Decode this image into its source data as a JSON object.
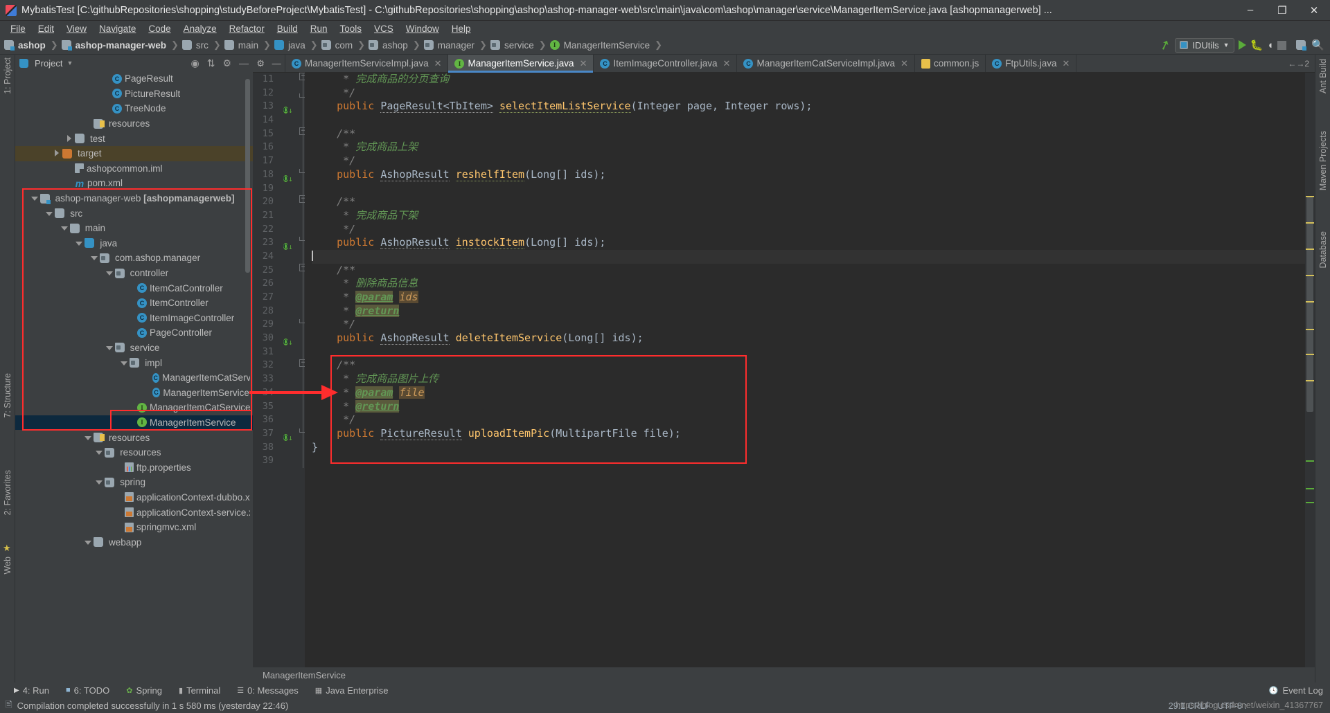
{
  "window": {
    "title": "MybatisTest [C:\\githubRepositories\\shopping\\studyBeforeProject\\MybatisTest] - C:\\githubRepositories\\shopping\\ashop\\ashop-manager-web\\src\\main\\java\\com\\ashop\\manager\\service\\ManagerItemService.java [ashopmanagerweb] ...",
    "minimize": "–",
    "maximize": "❐",
    "close": "✕"
  },
  "menubar": [
    {
      "label": "File"
    },
    {
      "label": "Edit"
    },
    {
      "label": "View"
    },
    {
      "label": "Navigate"
    },
    {
      "label": "Code"
    },
    {
      "label": "Analyze"
    },
    {
      "label": "Refactor"
    },
    {
      "label": "Build"
    },
    {
      "label": "Run"
    },
    {
      "label": "Tools"
    },
    {
      "label": "VCS"
    },
    {
      "label": "Window"
    },
    {
      "label": "Help"
    }
  ],
  "navbar": {
    "crumbs": [
      {
        "label": "ashop",
        "icon": "module-folder-icon",
        "bold": true
      },
      {
        "label": "ashop-manager-web",
        "icon": "module-folder-icon",
        "bold": true
      },
      {
        "label": "src",
        "icon": "folder-icon",
        "bold": false
      },
      {
        "label": "main",
        "icon": "folder-icon",
        "bold": false
      },
      {
        "label": "java",
        "icon": "source-folder-icon",
        "bold": false
      },
      {
        "label": "com",
        "icon": "package-icon",
        "bold": false
      },
      {
        "label": "ashop",
        "icon": "package-icon",
        "bold": false
      },
      {
        "label": "manager",
        "icon": "package-icon",
        "bold": false
      },
      {
        "label": "service",
        "icon": "package-icon",
        "bold": false
      },
      {
        "label": "ManagerItemService",
        "icon": "interface-icon",
        "bold": false
      }
    ],
    "run_config": "IDUtils",
    "buttons": [
      "run-button",
      "debug-button",
      "run-coverage-button",
      "stop-button",
      "project-structure-button",
      "search-everywhere-button"
    ]
  },
  "project_panel": {
    "title": "Project",
    "tools": [
      "locate-icon",
      "collapse-all-icon",
      "settings-icon",
      "hide-icon"
    ],
    "tree": [
      {
        "label": "PageResult",
        "indent": 7,
        "icon": "class-icon",
        "arrow": "none",
        "state": "normal"
      },
      {
        "label": "PictureResult",
        "indent": 7,
        "icon": "class-icon",
        "arrow": "none",
        "state": "normal"
      },
      {
        "label": "TreeNode",
        "indent": 7,
        "icon": "class-icon",
        "arrow": "none",
        "state": "normal"
      },
      {
        "label": "resources",
        "indent": 5.5,
        "icon": "resources-folder-icon",
        "arrow": "none",
        "state": "normal"
      },
      {
        "label": "test",
        "indent": 4,
        "icon": "folder-icon",
        "arrow": "right",
        "state": "normal"
      },
      {
        "label": "target",
        "indent": 3,
        "icon": "target-folder-icon",
        "arrow": "right",
        "state": "highlight"
      },
      {
        "label": "ashopcommon.iml",
        "indent": 4,
        "icon": "iml-icon",
        "arrow": "none",
        "state": "normal"
      },
      {
        "label": "pom.xml",
        "indent": 4,
        "icon": "maven-icon",
        "arrow": "none",
        "state": "normal"
      },
      {
        "label": "ashop-manager-web ",
        "bold_suffix": "[ashopmanagerweb]",
        "indent": 1.2,
        "icon": "module-folder-icon",
        "arrow": "down",
        "state": "normal"
      },
      {
        "label": "src",
        "indent": 2.4,
        "icon": "folder-icon",
        "arrow": "down",
        "state": "normal"
      },
      {
        "label": "main",
        "indent": 3.6,
        "icon": "folder-icon",
        "arrow": "down",
        "state": "normal"
      },
      {
        "label": "java",
        "indent": 4.8,
        "icon": "source-folder-icon",
        "arrow": "down",
        "state": "normal"
      },
      {
        "label": "com.ashop.manager",
        "indent": 6.0,
        "icon": "package-icon",
        "arrow": "down",
        "state": "normal"
      },
      {
        "label": "controller",
        "indent": 7.2,
        "icon": "package-icon",
        "arrow": "down",
        "state": "normal"
      },
      {
        "label": "ItemCatController",
        "indent": 9.0,
        "icon": "class-icon",
        "arrow": "none",
        "state": "normal"
      },
      {
        "label": "ItemController",
        "indent": 9.0,
        "icon": "class-icon",
        "arrow": "none",
        "state": "normal"
      },
      {
        "label": "ItemImageController",
        "indent": 9.0,
        "icon": "class-icon",
        "arrow": "none",
        "state": "normal"
      },
      {
        "label": "PageController",
        "indent": 9.0,
        "icon": "class-icon",
        "arrow": "none",
        "state": "normal"
      },
      {
        "label": "service",
        "indent": 7.2,
        "icon": "package-icon",
        "arrow": "down",
        "state": "normal"
      },
      {
        "label": "impl",
        "indent": 8.4,
        "icon": "package-icon",
        "arrow": "down",
        "state": "normal"
      },
      {
        "label": "ManagerItemCatServiceImpl",
        "indent": 10.2,
        "icon": "class-icon",
        "arrow": "none",
        "state": "normal"
      },
      {
        "label": "ManagerItemServiceImpl",
        "indent": 10.2,
        "icon": "class-icon",
        "arrow": "none",
        "state": "normal"
      },
      {
        "label": "ManagerItemCatService",
        "indent": 9.0,
        "icon": "interface-icon",
        "arrow": "none",
        "state": "normal"
      },
      {
        "label": "ManagerItemService",
        "indent": 9.0,
        "icon": "interface-icon",
        "arrow": "none",
        "state": "selected"
      },
      {
        "label": "resources",
        "indent": 5.5,
        "icon": "resources-folder-icon",
        "arrow": "down",
        "state": "normal"
      },
      {
        "label": "resources",
        "indent": 6.4,
        "icon": "package-icon",
        "arrow": "down",
        "state": "normal"
      },
      {
        "label": "ftp.properties",
        "indent": 8.0,
        "icon": "properties-icon",
        "arrow": "none",
        "state": "normal"
      },
      {
        "label": "spring",
        "indent": 6.4,
        "icon": "package-icon",
        "arrow": "down",
        "state": "normal"
      },
      {
        "label": "applicationContext-dubbo.xml",
        "indent": 8.0,
        "icon": "xml-icon",
        "arrow": "none",
        "state": "normal"
      },
      {
        "label": "applicationContext-service.xml",
        "indent": 8.0,
        "icon": "xml-icon",
        "arrow": "none",
        "state": "normal"
      },
      {
        "label": "springmvc.xml",
        "indent": 8.0,
        "icon": "xml-icon",
        "arrow": "none",
        "state": "normal"
      },
      {
        "label": "webapp",
        "indent": 5.5,
        "icon": "folder-icon",
        "arrow": "down",
        "state": "normal"
      }
    ]
  },
  "left_strip": [
    {
      "label": "1: Project"
    },
    {
      "label": "7: Structure"
    },
    {
      "label": "2: Favorites"
    },
    {
      "label": "Web"
    }
  ],
  "right_strip": [
    {
      "label": "Ant Build"
    },
    {
      "label": "Maven Projects"
    },
    {
      "label": "Database"
    }
  ],
  "editor": {
    "tabs": [
      {
        "label": "ManagerItemServiceImpl.java",
        "icon": "class-icon",
        "active": false,
        "close": "✕"
      },
      {
        "label": "ManagerItemService.java",
        "icon": "interface-icon",
        "active": true,
        "close": "✕"
      },
      {
        "label": "ItemImageController.java",
        "icon": "class-icon",
        "active": false,
        "close": "✕"
      },
      {
        "label": "ManagerItemCatServiceImpl.java",
        "icon": "class-icon",
        "active": false,
        "close": "✕"
      },
      {
        "label": "common.js",
        "icon": "js-icon",
        "active": false,
        "close": ""
      },
      {
        "label": "FtpUtils.java",
        "icon": "class-icon",
        "active": false,
        "close": "✕"
      }
    ],
    "tab_overflow": "←→2",
    "breadcrumb": "ManagerItemService",
    "lines": [
      {
        "n": 11,
        "text": " *  完成商品的分页查询",
        "kind": "comment"
      },
      {
        "n": 12,
        "text": " */",
        "kind": "comment"
      },
      {
        "n": 13,
        "text": "public PageResult<TbItem> selectItemListService(Integer page, Integer rows);",
        "kind": "code",
        "marker": true
      },
      {
        "n": 14,
        "text": "",
        "kind": "blank"
      },
      {
        "n": 15,
        "text": "/**",
        "kind": "comment"
      },
      {
        "n": 16,
        "text": " *  完成商品上架",
        "kind": "comment"
      },
      {
        "n": 17,
        "text": " */",
        "kind": "comment"
      },
      {
        "n": 18,
        "text": "public AshopResult reshelfItem(Long[] ids);",
        "kind": "code",
        "marker": true
      },
      {
        "n": 19,
        "text": "",
        "kind": "blank"
      },
      {
        "n": 20,
        "text": "/**",
        "kind": "comment"
      },
      {
        "n": 21,
        "text": " *  完成商品下架",
        "kind": "comment"
      },
      {
        "n": 22,
        "text": " */",
        "kind": "comment"
      },
      {
        "n": 23,
        "text": "public AshopResult instockItem(Long[] ids);",
        "kind": "code",
        "marker": true
      },
      {
        "n": 24,
        "text": "",
        "kind": "caret"
      },
      {
        "n": 25,
        "text": "/**",
        "kind": "comment"
      },
      {
        "n": 26,
        "text": " *  删除商品信息",
        "kind": "comment"
      },
      {
        "n": 27,
        "text": " *  @param ids",
        "kind": "javadoc-param"
      },
      {
        "n": 28,
        "text": " *  @return",
        "kind": "javadoc-return"
      },
      {
        "n": 29,
        "text": " */",
        "kind": "comment"
      },
      {
        "n": 30,
        "text": "public AshopResult deleteItemService(Long[] ids);",
        "kind": "code",
        "marker": true
      },
      {
        "n": 31,
        "text": "",
        "kind": "blank"
      },
      {
        "n": 32,
        "text": "/**",
        "kind": "comment"
      },
      {
        "n": 33,
        "text": " *  完成商品图片上传",
        "kind": "comment"
      },
      {
        "n": 34,
        "text": " *  @param file",
        "kind": "javadoc-param"
      },
      {
        "n": 35,
        "text": " *  @return",
        "kind": "javadoc-return"
      },
      {
        "n": 36,
        "text": " */",
        "kind": "comment"
      },
      {
        "n": 37,
        "text": "public PictureResult uploadItemPic(MultipartFile file);",
        "kind": "code",
        "marker": true
      },
      {
        "n": 38,
        "text": "}",
        "kind": "code"
      },
      {
        "n": 39,
        "text": "",
        "kind": "blank"
      }
    ],
    "code_tokens": {
      "kw_public": "public",
      "t_PageResult": "PageResult<TbItem>",
      "m_select": "selectItemListService",
      "p_select": "(Integer page, Integer rows);",
      "t_AshopResult": "AshopResult",
      "m_reshelf": "reshelfItem",
      "p_ids": "(Long[] ids);",
      "m_instock": "instockItem",
      "m_delete": "deleteItemService",
      "t_PictureResult": "PictureResult",
      "m_upload": "uploadItemPic",
      "p_file": "(MultipartFile file);",
      "param_tag": "@param",
      "return_tag": "@return",
      "param_ids": "ids",
      "param_file": "file",
      "comment_open": "/**",
      "comment_close": " */",
      "star": " * ",
      "brace_close": "}"
    }
  },
  "bottom_bar": {
    "items": [
      {
        "label": "4: Run",
        "underline": "4",
        "icon": "run-triangle-icon"
      },
      {
        "label": "6: TODO",
        "underline": "6",
        "icon": "todo-icon"
      },
      {
        "label": "Spring",
        "icon": "spring-icon"
      },
      {
        "label": "Terminal",
        "icon": "terminal-icon"
      },
      {
        "label": "0: Messages",
        "underline": "0",
        "icon": "messages-icon"
      },
      {
        "label": "Java Enterprise",
        "icon": "java-ee-icon"
      }
    ],
    "event_log": "Event Log"
  },
  "status_bar": {
    "message": "Compilation completed successfully in 1 s 580 ms (yesterday 22:46)",
    "watermark": "https://blog.csdn.net/weixin_41367767",
    "watermark2": "29:1  CRLF :  UTF-8 :"
  },
  "annotations": {
    "arrow_color": "#ff2d2d",
    "box_color": "#ff2d2d"
  }
}
